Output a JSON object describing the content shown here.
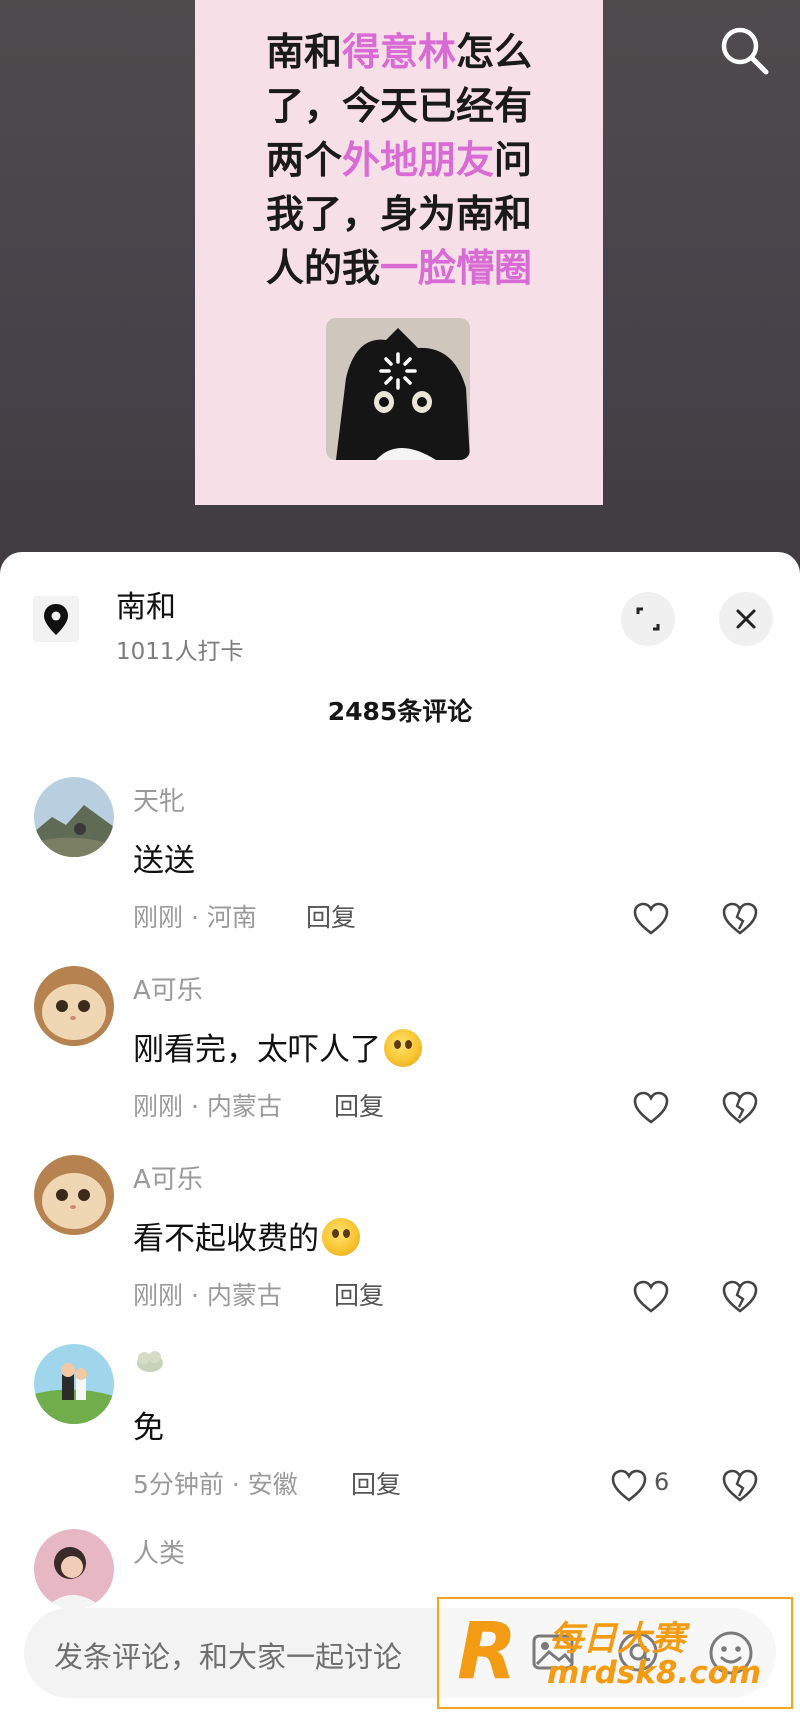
{
  "poster": {
    "lines": [
      [
        {
          "t": "南和",
          "hl": false
        },
        {
          "t": "得意林",
          "hl": true
        },
        {
          "t": "怎么",
          "hl": false
        }
      ],
      [
        {
          "t": "了，今天已经有",
          "hl": false
        }
      ],
      [
        {
          "t": "两个",
          "hl": false
        },
        {
          "t": "外地朋友",
          "hl": true
        },
        {
          "t": "问",
          "hl": false
        }
      ],
      [
        {
          "t": "我了，身为南和",
          "hl": false
        }
      ],
      [
        {
          "t": "人的我",
          "hl": false
        },
        {
          "t": "一脸懵圈",
          "hl": true
        }
      ]
    ],
    "highlight_color": "#d86bd4"
  },
  "top_icons": {
    "search": "search-icon"
  },
  "sheet": {
    "location_name": "南和",
    "location_count": "1011人打卡",
    "comment_count": "2485条评论",
    "icons": {
      "location": "location-pin-icon",
      "expand": "expand-icon",
      "close": "close-icon"
    }
  },
  "comments": [
    {
      "user": "天牝",
      "text": "送送",
      "emoji": false,
      "meta": "刚刚 · 河南",
      "reply": "回复",
      "likes": "",
      "avatar": "landscape"
    },
    {
      "user": "A可乐",
      "text": "刚看完，太吓人了",
      "emoji": true,
      "meta": "刚刚 · 内蒙古",
      "reply": "回复",
      "likes": "",
      "avatar": "cat"
    },
    {
      "user": "A可乐",
      "text": "看不起收费的",
      "emoji": true,
      "meta": "刚刚 · 内蒙古",
      "reply": "回复",
      "likes": "",
      "avatar": "cat"
    },
    {
      "user": "",
      "text": "免",
      "emoji": false,
      "meta": "5分钟前 · 安徽",
      "reply": "回复",
      "likes": "6",
      "avatar": "cartoon"
    },
    {
      "user": "人类",
      "text": "",
      "emoji": false,
      "meta": "",
      "reply": "",
      "likes": "",
      "avatar": "person"
    }
  ],
  "input": {
    "placeholder": "发条评论，和大家一起讨论",
    "icons": {
      "image": "image-icon",
      "at": "at-icon",
      "emoji": "emoji-icon"
    }
  },
  "watermark": {
    "top": "每日大赛",
    "bottom": "mrdsk8.com",
    "logo": "R",
    "color": "#f39b12"
  }
}
